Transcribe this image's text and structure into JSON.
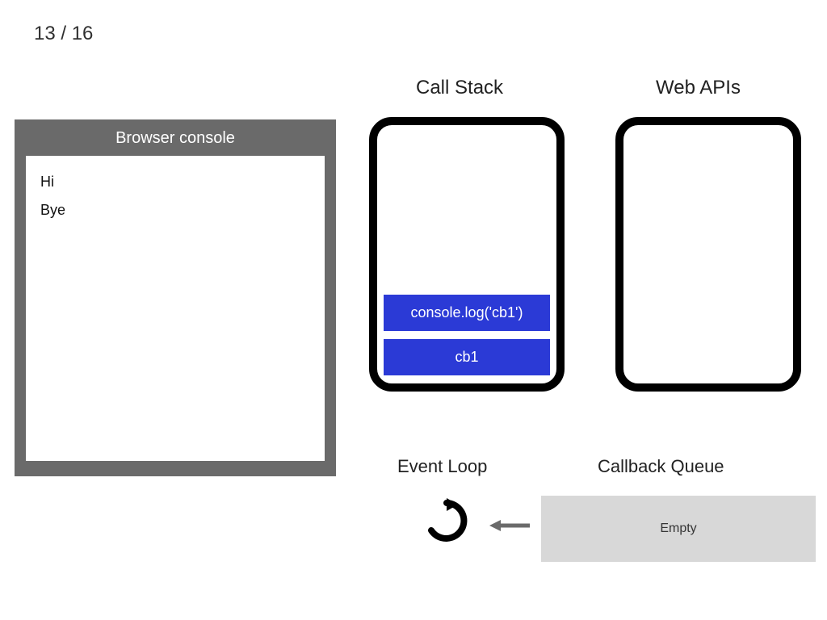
{
  "step": {
    "current": 13,
    "total": 16,
    "display": "13 / 16"
  },
  "titles": {
    "console": "Browser console",
    "call_stack": "Call Stack",
    "web_apis": "Web APIs",
    "event_loop": "Event Loop",
    "callback_queue": "Callback Queue"
  },
  "console_output": [
    "Hi",
    "Bye"
  ],
  "call_stack": [
    "console.log('cb1')",
    "cb1"
  ],
  "web_apis": [],
  "callback_queue": {
    "empty_label": "Empty",
    "items": []
  },
  "colors": {
    "frame_bg": "#2b3ad6",
    "panel_bg": "#6a6a6a",
    "queue_bg": "#d8d8d8"
  }
}
